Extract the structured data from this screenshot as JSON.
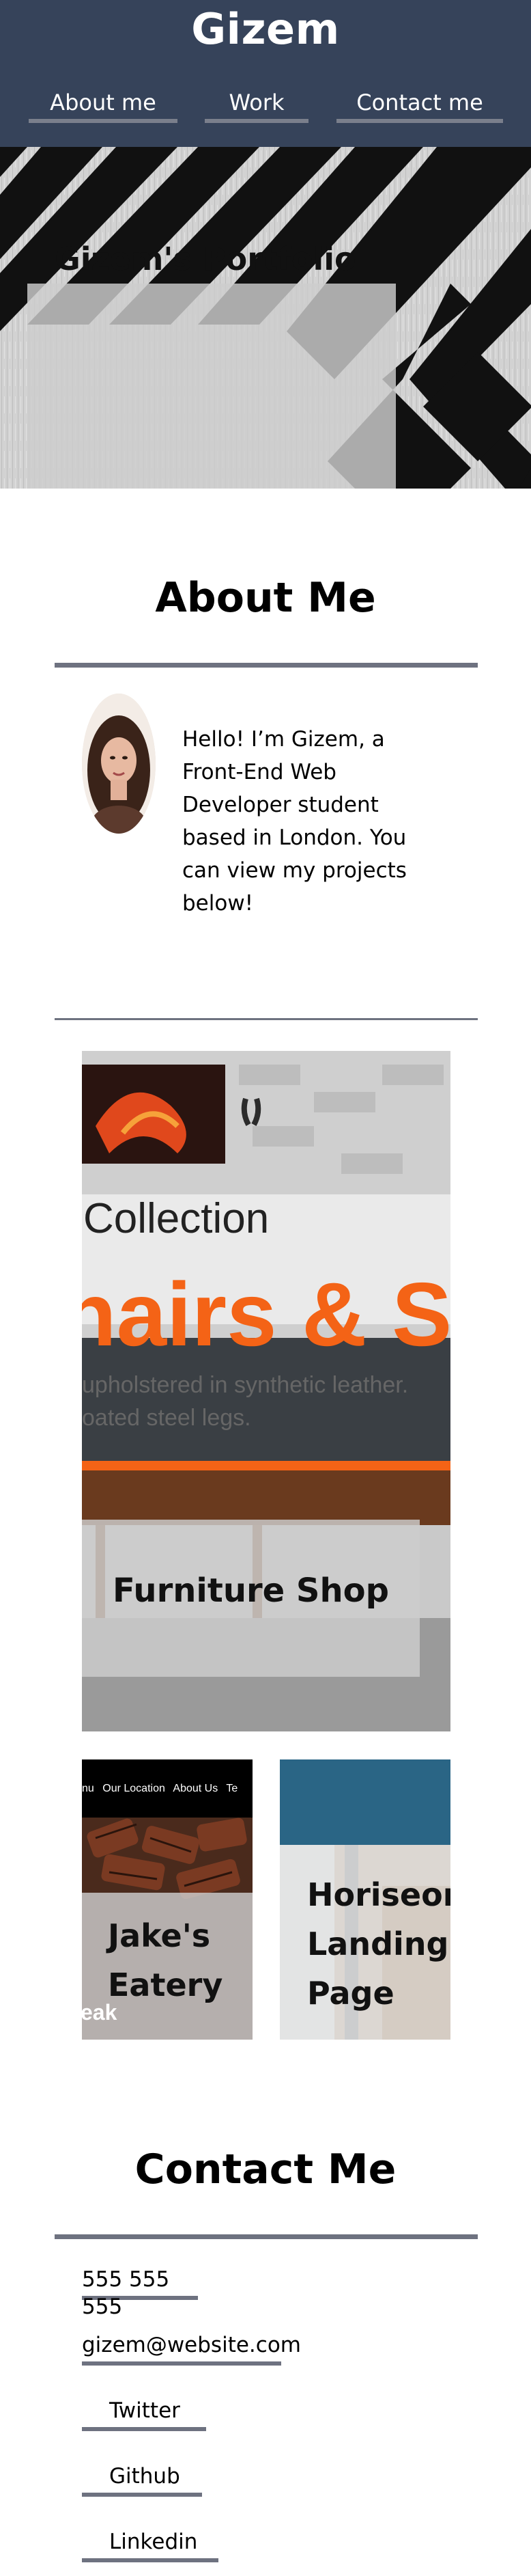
{
  "header": {
    "site_title": "Gizem",
    "nav": {
      "about": "About me",
      "work": "Work",
      "contact": "Contact me"
    }
  },
  "hero": {
    "caption": "Gizem's Portfolio"
  },
  "about": {
    "title": "About Me",
    "bio": "Hello! I’m Gizem, a Front-End Web Developer student based in London. You can view my projects below!"
  },
  "projects": {
    "furniture": {
      "screenshot_title": "Collection",
      "screenshot_headline": "hairs & Sto",
      "screenshot_desc_line1": "upholstered in synthetic leather.",
      "screenshot_desc_line2": "oated steel legs.",
      "caption": "Furniture Shop"
    },
    "jake": {
      "nav_items": [
        "nu",
        "Our Location",
        "About Us",
        "Te"
      ],
      "caption": "Jake's Eatery",
      "screenshot_fragment": "eak"
    },
    "horiseon": {
      "caption": "Horiseon Landing Page"
    }
  },
  "contact": {
    "title": "Contact Me",
    "phone": "555 555 555",
    "email": "gizem@website.com",
    "twitter": "Twitter",
    "github": "Github",
    "linkedin": "Linkedin"
  },
  "colors": {
    "header_bg": "#36435a",
    "divider": "#6e7280",
    "furniture_accent": "#f46316",
    "horiseon_banner": "#2a6585"
  }
}
